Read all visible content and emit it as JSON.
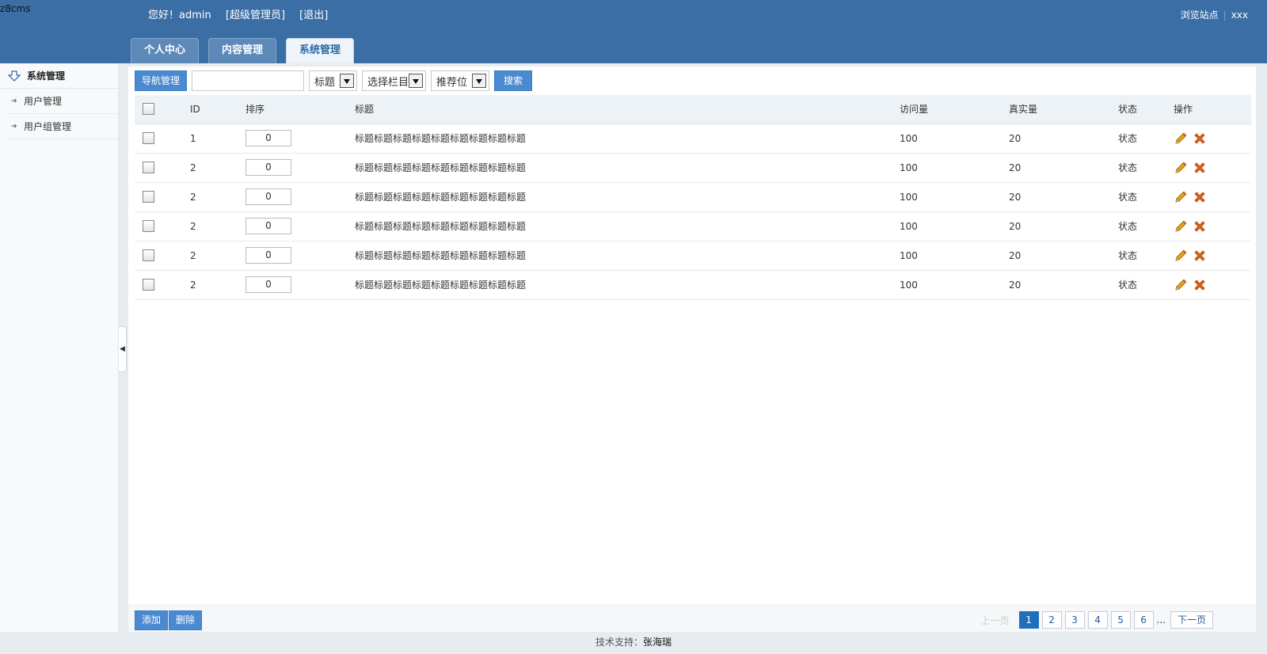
{
  "header": {
    "logo": "z8cms",
    "greeting": "您好！admin",
    "role": "[超级管理员]",
    "logout": "[退出]",
    "browse_site": "浏览站点",
    "extra": "xxx",
    "tabs": [
      {
        "label": "个人中心",
        "active": false
      },
      {
        "label": "内容管理",
        "active": false
      },
      {
        "label": "系统管理",
        "active": true
      }
    ]
  },
  "sidebar": {
    "title": "系统管理",
    "items": [
      {
        "label": "用户管理"
      },
      {
        "label": "用户组管理"
      }
    ]
  },
  "toolbar": {
    "nav_button": "导航管理",
    "search_value": "",
    "select_title": "标题",
    "select_column": "选择栏目",
    "select_recommend": "推荐位",
    "search_button": "搜索"
  },
  "table": {
    "headers": [
      "ID",
      "排序",
      "标题",
      "访问量",
      "真实量",
      "状态",
      "操作"
    ],
    "rows": [
      {
        "id": "1",
        "order": "0",
        "title": "标题标题标题标题标题标题标题标题标题",
        "visits": "100",
        "real": "20",
        "status": "状态"
      },
      {
        "id": "2",
        "order": "0",
        "title": "标题标题标题标题标题标题标题标题标题",
        "visits": "100",
        "real": "20",
        "status": "状态"
      },
      {
        "id": "2",
        "order": "0",
        "title": "标题标题标题标题标题标题标题标题标题",
        "visits": "100",
        "real": "20",
        "status": "状态"
      },
      {
        "id": "2",
        "order": "0",
        "title": "标题标题标题标题标题标题标题标题标题",
        "visits": "100",
        "real": "20",
        "status": "状态"
      },
      {
        "id": "2",
        "order": "0",
        "title": "标题标题标题标题标题标题标题标题标题",
        "visits": "100",
        "real": "20",
        "status": "状态"
      },
      {
        "id": "2",
        "order": "0",
        "title": "标题标题标题标题标题标题标题标题标题",
        "visits": "100",
        "real": "20",
        "status": "状态"
      }
    ]
  },
  "bottom": {
    "add_button": "添加",
    "delete_button": "删除",
    "prev": "上一页",
    "pages": [
      "1",
      "2",
      "3",
      "4",
      "5",
      "6"
    ],
    "current_page": "1",
    "ellipsis": "...",
    "next": "下一页"
  },
  "footer": {
    "label": "技术支持：",
    "name": "张海瑞"
  },
  "colors": {
    "header_bg": "#3a6ea5",
    "accent": "#4a8ad0",
    "active_page": "#1f6fbd",
    "delete_icon": "#e0661c",
    "edit_icon": "#e8a317"
  }
}
